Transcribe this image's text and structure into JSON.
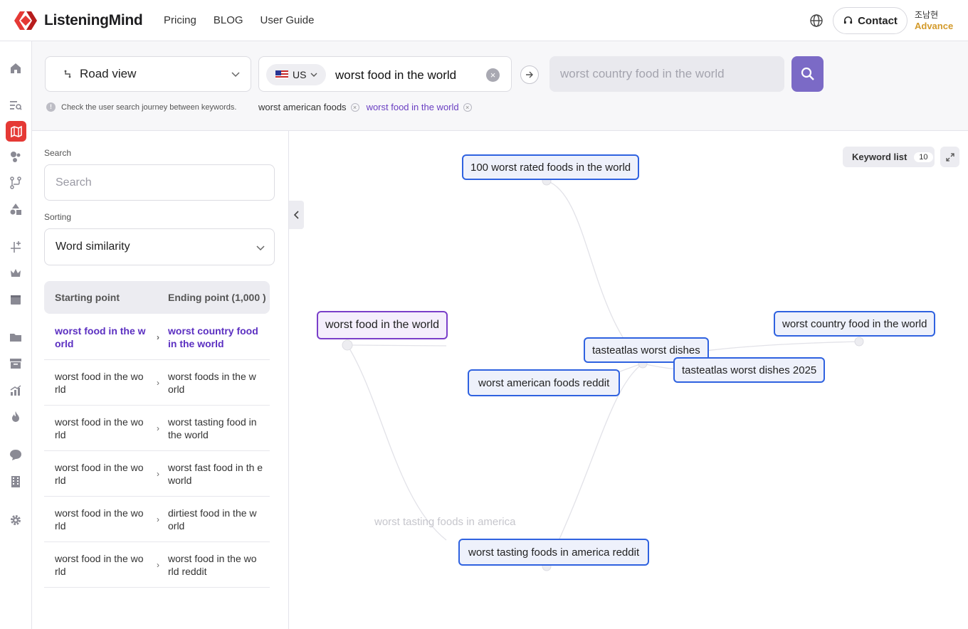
{
  "brand": {
    "name": "ListeningMind",
    "accent": "#e53935",
    "purple": "#7b6ac6"
  },
  "nav": [
    "Pricing",
    "BLOG",
    "User Guide"
  ],
  "header": {
    "contact_label": "Contact",
    "user_name": "조남현",
    "user_plan": "Advance"
  },
  "sidebar": {
    "icons": [
      "home-icon",
      "list-search-icon",
      "map-icon",
      "cluster-icon",
      "path-icon",
      "shapes-icon",
      "chart-plus-icon",
      "crown-icon",
      "calendar-icon",
      "folder-icon",
      "archive-icon",
      "bar-chart-icon",
      "fire-icon",
      "chat-icon",
      "building-icon",
      "gear-icon"
    ],
    "active": "map-icon"
  },
  "toolbar": {
    "view_label": "Road view",
    "country_label": "US",
    "search_value": "worst food in the world",
    "end_placeholder": "worst country food in the world",
    "hint": "Check the user search journey between keywords.",
    "chips": [
      {
        "label": "worst american foods",
        "active": false
      },
      {
        "label": "worst food in the world",
        "active": true
      }
    ]
  },
  "panel": {
    "search_label": "Search",
    "search_placeholder": "Search",
    "sorting_label": "Sorting",
    "sorting_value": "Word similarity",
    "col_start": "Starting point",
    "col_end": "Ending point (1,000 )",
    "rows": [
      {
        "start": "worst food in the w orld",
        "end": "worst country food in the world",
        "selected": true
      },
      {
        "start": "worst food in the wo rld",
        "end": "worst foods in the w orld",
        "selected": false
      },
      {
        "start": "worst food in the wo rld",
        "end": "worst tasting food in the world",
        "selected": false
      },
      {
        "start": "worst food in the wo rld",
        "end": "worst fast food in th e world",
        "selected": false
      },
      {
        "start": "worst food in the wo rld",
        "end": "dirtiest food in the w orld",
        "selected": false
      },
      {
        "start": "worst food in the wo rld",
        "end": "worst food in the wo rld reddit",
        "selected": false
      }
    ]
  },
  "canvas": {
    "keyword_list_label": "Keyword list",
    "keyword_count": "10",
    "nodes": {
      "start": "worst food in the world",
      "n1": "100 worst rated foods in the world",
      "n2": "tasteatlas worst dishes",
      "n3": "tasteatlas worst dishes 2025",
      "n4": "worst american foods reddit",
      "n5": "worst country food in the world",
      "n6": "worst tasting foods in america reddit",
      "ghost": "worst tasting foods in america"
    }
  }
}
